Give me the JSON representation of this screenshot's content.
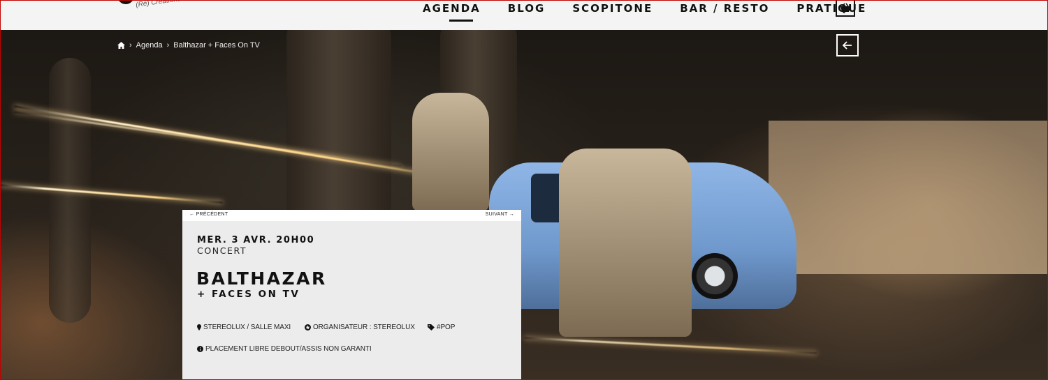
{
  "header": {
    "logo_tagline": "(Ré) Créations mus",
    "nav": [
      {
        "label": "AGENDA",
        "active": true
      },
      {
        "label": "BLOG",
        "active": false
      },
      {
        "label": "SCOPITONE",
        "active": false
      },
      {
        "label": "BAR / RESTO",
        "active": false
      },
      {
        "label": "PRATIQUE",
        "active": false
      }
    ],
    "basket_icon": "basket-icon"
  },
  "breadcrumb": {
    "items": [
      "Agenda",
      "Balthazar + Faces On TV"
    ],
    "home_icon": "home-icon"
  },
  "back_icon": "arrow-left-icon",
  "event": {
    "prev_label": "PRÉCÉDENT",
    "next_label": "SUIVANT",
    "date": "MER. 3 AVR. 20H00",
    "type": "CONCERT",
    "title": "BALTHAZAR",
    "subtitle": "+ FACES ON TV",
    "venue": "STEREOLUX / SALLE MAXI",
    "organizer": "ORGANISATEUR : STEREOLUX",
    "tag": "#POP",
    "seating": "PLACEMENT LIBRE DEBOUT/ASSIS NON GARANTI"
  },
  "colors": {
    "header_bg": "#f4f4f4",
    "card_bg": "#ececec",
    "accent": "#111111"
  }
}
